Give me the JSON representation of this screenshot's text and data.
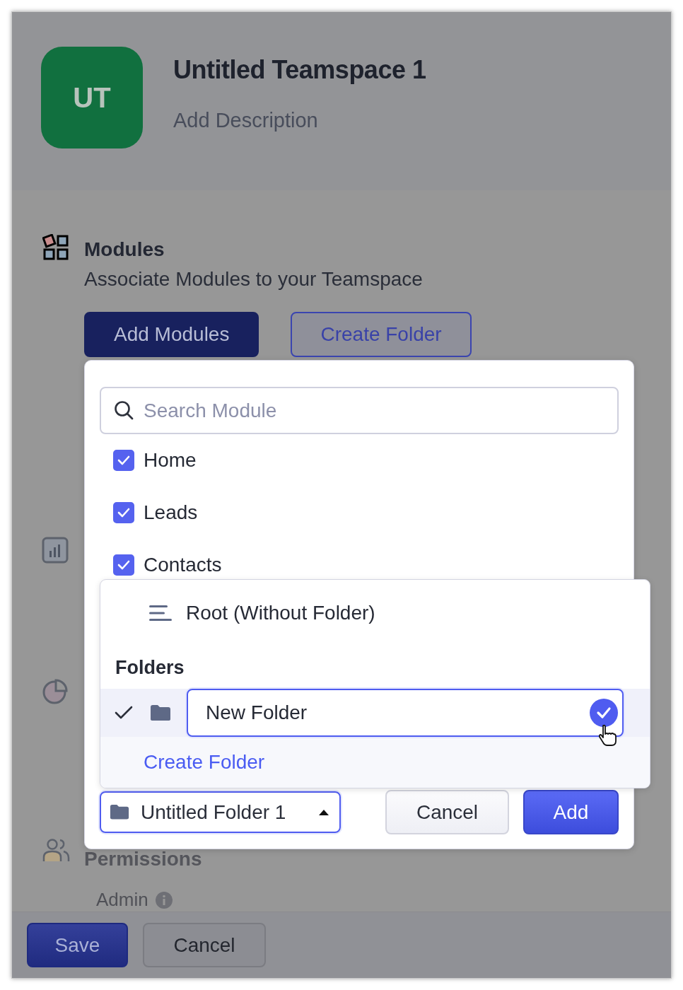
{
  "header": {
    "avatar": "UT",
    "title": "Untitled Teamspace 1",
    "description": "Add Description"
  },
  "modules": {
    "title": "Modules",
    "subtitle": "Associate Modules to your Teamspace",
    "buttons": [
      {
        "label": "Add Modules",
        "kind": "primary"
      },
      {
        "label": "Create Folder",
        "kind": "outline"
      }
    ]
  },
  "permissions": {
    "title": "Permissions",
    "role": "Admin"
  },
  "footer": {
    "buttons": [
      {
        "label": "Save",
        "kind": "primary"
      },
      {
        "label": "Cancel",
        "kind": "secondary"
      }
    ]
  },
  "module_picker": {
    "search": {
      "placeholder": "Search Module"
    },
    "modules": [
      {
        "label": "Home",
        "checked": true
      },
      {
        "label": "Leads",
        "checked": true
      },
      {
        "label": "Contacts",
        "checked": true
      }
    ],
    "folder_select": {
      "value": "Untitled Folder 1",
      "expanded": true
    },
    "buttons": [
      {
        "label": "Cancel",
        "kind": "secondary"
      },
      {
        "label": "Add",
        "kind": "primary"
      }
    ]
  },
  "folder_menu": {
    "root": "Root (Without Folder)",
    "section": "Folders",
    "folders": [
      {
        "name": "New Folder",
        "selected": true,
        "kind": "editing"
      }
    ],
    "create_link": "Create Folder"
  }
}
